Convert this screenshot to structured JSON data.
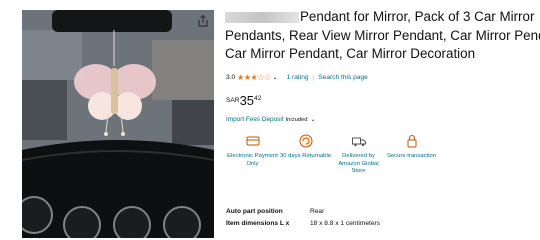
{
  "product": {
    "title_line1": "Pendant for Mirror, Pack of 3 Car Mirror",
    "title_line2": "Pendants, Rear View Mirror Pendant, Car Mirror Pendant",
    "title_line3": "Car Mirror Pendant, Car Mirror Decoration"
  },
  "rating": {
    "value": "3.0",
    "stars": "★★★☆☆",
    "count_label": "1 rating",
    "separator": "|",
    "search_label": "Search this page"
  },
  "price": {
    "currency": "SAR",
    "whole": "35",
    "fraction": "42"
  },
  "import_fees": {
    "label": "Import Fees Deposit",
    "included": "Included"
  },
  "features": [
    {
      "label": "Electronic Payment Only",
      "icon": "card-icon"
    },
    {
      "label": "30 days Returnable",
      "icon": "return-icon"
    },
    {
      "label": "Delivered by Amazon Global Store",
      "icon": "truck-icon"
    },
    {
      "label": "Secure transaction",
      "icon": "lock-icon"
    }
  ],
  "specs": [
    {
      "key": "Auto part position",
      "value": "Rear"
    },
    {
      "key": "Item dimensions L x",
      "value": "18 x 8.8 x 1 centimeters"
    }
  ],
  "colors": {
    "link": "#007185",
    "star": "#de7921",
    "text": "#0f1111"
  }
}
